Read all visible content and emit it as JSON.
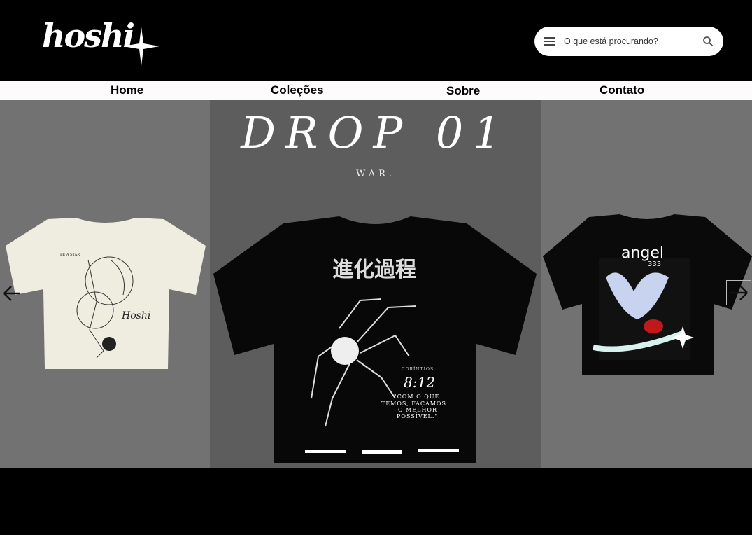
{
  "brand": {
    "logo_text": "hoshi"
  },
  "search": {
    "placeholder": "O que está procurando?"
  },
  "nav": {
    "items": [
      "Home",
      "Coleções",
      "Sobre",
      "Contato"
    ]
  },
  "hero": {
    "title": "DROP 01",
    "subtitle": "WAR.",
    "slides": [
      {
        "print_top": "BE A STAR.",
        "signature": "Hoshi"
      },
      {
        "kanji": "進化過程",
        "verse_ref": "CORÍNTIOS",
        "verse_num": "8:12",
        "quote_lines": [
          "\"COM O QUE",
          "TEMOS, FAÇAMOS",
          "O MELHOR",
          "POSSÍVEL.\""
        ]
      },
      {
        "print_text": "angel",
        "print_num": "333"
      }
    ],
    "indicator_count": 3
  },
  "colors": {
    "background": "#000000",
    "nav_bg": "#fdfbfc",
    "carousel_bg": "#727272",
    "center_panel": "#5d5d5d"
  }
}
